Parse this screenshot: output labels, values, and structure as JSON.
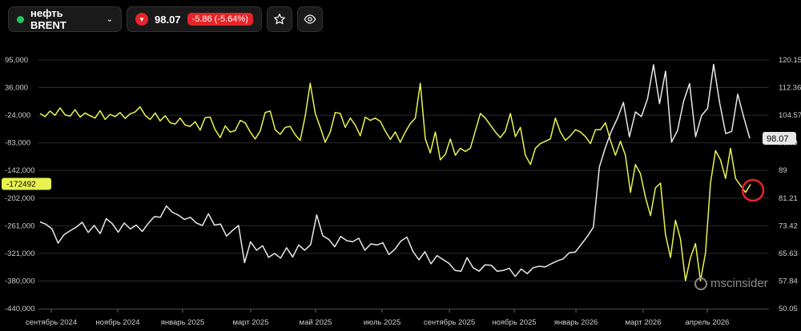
{
  "toolbar": {
    "ticker": "нефть BRENT",
    "price": "98.07",
    "change": "-5.86 (-5.64%)",
    "star_icon": "star-icon",
    "eye_icon": "eye-icon"
  },
  "watermark": "mscinsider",
  "colors": {
    "yellow": "#e9f34f",
    "white": "#e8e8e8",
    "red": "#e5252a",
    "status": "#22c55e"
  },
  "chart_data": {
    "type": "line",
    "x_labels": [
      "сентябрь 2024",
      "ноябрь 2024",
      "январь 2025",
      "март 2025",
      "май 2025",
      "июль 2025",
      "сентябрь 2025",
      "ноябрь 2025",
      "январь 2026",
      "март 2026",
      "апрель 2026"
    ],
    "left_axis": {
      "ticks": [
        "95,000",
        "36,000",
        "-24,000",
        "-83,000",
        "-142,000",
        "-202,000",
        "-261,000",
        "-321,000",
        "-380,000",
        "-440,000"
      ],
      "range": [
        -440000,
        95000
      ]
    },
    "right_axis": {
      "ticks": [
        "120.15",
        "112.36",
        "104.57",
        "96.79",
        "89",
        "81.21",
        "73.42",
        "65.63",
        "57.84",
        "50.05"
      ],
      "range": [
        50.05,
        120.15
      ]
    },
    "left_label": "-172492",
    "right_label": "98.07",
    "series": [
      {
        "axis": "left",
        "color": "#e9f34f",
        "values": [
          -20000,
          -27000,
          -15000,
          -24000,
          -8000,
          -23000,
          -26000,
          -12000,
          -28000,
          -19000,
          -25000,
          -30000,
          -14000,
          -33000,
          -22000,
          -27000,
          -18000,
          -31000,
          -21000,
          -17000,
          -6000,
          -24000,
          -33000,
          -19000,
          -36000,
          -25000,
          -40000,
          -43000,
          -30000,
          -45000,
          -48000,
          -38000,
          -56000,
          -29000,
          -28000,
          -55000,
          -72000,
          -47000,
          -60000,
          -57000,
          -35000,
          -40000,
          -60000,
          -75000,
          -58000,
          -18000,
          -15000,
          -55000,
          -65000,
          -50000,
          -48000,
          -66000,
          -78000,
          -25000,
          45000,
          -20000,
          -50000,
          -82000,
          -60000,
          -18000,
          -20000,
          -50000,
          -30000,
          -45000,
          -68000,
          -28000,
          -35000,
          -30000,
          -37000,
          -58000,
          -76000,
          -60000,
          -82000,
          -60000,
          -42000,
          -30000,
          45000,
          -75000,
          -105000,
          -60000,
          -120000,
          -108000,
          -75000,
          -110000,
          -95000,
          -102000,
          -95000,
          -58000,
          -20000,
          -30000,
          -45000,
          -60000,
          -72000,
          -58000,
          -20000,
          -70000,
          -50000,
          -110000,
          -130000,
          -95000,
          -85000,
          -80000,
          -75000,
          -30000,
          -60000,
          -78000,
          -68000,
          -55000,
          -60000,
          -70000,
          -85000,
          -55000,
          -55000,
          -40000,
          -78000,
          -110000,
          -80000,
          -110000,
          -190000,
          -130000,
          -150000,
          -200000,
          -240000,
          -180000,
          -170000,
          -280000,
          -330000,
          -250000,
          -290000,
          -380000,
          -330000,
          -300000,
          -380000,
          -320000,
          -170000,
          -100000,
          -120000,
          -160000,
          -95000,
          -160000,
          -175000,
          -190000,
          -172492
        ]
      },
      {
        "axis": "right",
        "color": "#e8e8e8",
        "values": [
          74.5,
          73.8,
          72.5,
          68.5,
          70.9,
          72.0,
          73.0,
          74.4,
          71.5,
          73.5,
          71.2,
          75.4,
          74.0,
          71.6,
          74.2,
          72.5,
          73.6,
          71.8,
          74.1,
          76.0,
          75.8,
          79.0,
          77.2,
          76.4,
          75.2,
          75.8,
          74.2,
          73.5,
          76.8,
          73.6,
          73.9,
          70.5,
          72.1,
          73.5,
          63.0,
          68.9,
          66.5,
          67.8,
          64.5,
          65.6,
          64.3,
          67.2,
          64.6,
          68.0,
          66.5,
          68.1,
          76.5,
          70.6,
          69.6,
          67.5,
          70.4,
          69.2,
          68.9,
          69.9,
          66.5,
          68.3,
          68.0,
          68.6,
          65.3,
          66.8,
          69.1,
          70.2,
          66.2,
          63.8,
          66.1,
          62.7,
          65.0,
          63.9,
          62.8,
          60.8,
          60.6,
          64.4,
          61.6,
          60.6,
          62.4,
          62.3,
          60.6,
          60.8,
          61.4,
          59.1,
          61.2,
          59.9,
          61.6,
          62.0,
          61.8,
          62.7,
          63.5,
          64.1,
          65.8,
          66.0,
          68.2,
          70.4,
          73.0,
          90.0,
          95.5,
          100.1,
          103.7,
          108.2,
          98.5,
          105.5,
          104.2,
          109.2,
          118.8,
          107.8,
          117.0,
          97.0,
          100.3,
          108.5,
          113.5,
          98.5,
          104.5,
          106.5,
          118.9,
          108.0,
          99.4,
          100.0,
          110.5,
          104.0,
          98.07
        ]
      }
    ],
    "annotations": [
      "red circle marking the end of the yellow series"
    ]
  }
}
